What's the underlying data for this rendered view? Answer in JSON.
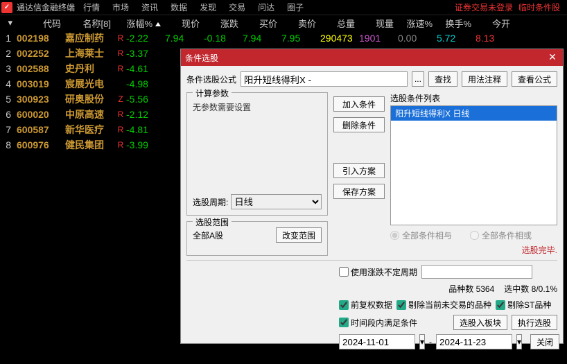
{
  "topbar": {
    "title": "通达信金融终端",
    "menu": [
      "行情",
      "市场",
      "资讯",
      "数据",
      "发现",
      "交易",
      "问达",
      "圈子"
    ],
    "right": [
      "证券交易未登录",
      "临时条件股"
    ]
  },
  "columns": {
    "idx": "",
    "code": "代码",
    "name": "名称[8]",
    "pct": "涨幅%",
    "price": "现价",
    "chg": "涨跌",
    "bid": "买价",
    "ask": "卖价",
    "vol": "总量",
    "amt": "现量",
    "speed": "涨速%",
    "turn": "换手%",
    "open": "今开"
  },
  "rows": [
    {
      "idx": "1",
      "code": "002198",
      "name": "嘉应制药",
      "flag": "R",
      "pct": "-2.22",
      "price": "7.94",
      "chg": "-0.18",
      "bid": "7.94",
      "ask": "7.95",
      "vol": "290473",
      "amt": "1901",
      "speed": "0.00",
      "turn": "5.72",
      "open": "8.13"
    },
    {
      "idx": "2",
      "code": "002252",
      "name": "上海莱士",
      "flag": "R",
      "pct": "-3.37"
    },
    {
      "idx": "3",
      "code": "002588",
      "name": "史丹利",
      "flag": "R",
      "pct": "-4.61"
    },
    {
      "idx": "4",
      "code": "003019",
      "name": "宸展光电",
      "flag": "",
      "pct": "-4.98"
    },
    {
      "idx": "5",
      "code": "300923",
      "name": "研奥股份",
      "flag": "Z",
      "pct": "-5.56"
    },
    {
      "idx": "6",
      "code": "600020",
      "name": "中原高速",
      "flag": "R",
      "pct": "-2.12"
    },
    {
      "idx": "7",
      "code": "600587",
      "name": "新华医疗",
      "flag": "R",
      "pct": "-4.81"
    },
    {
      "idx": "8",
      "code": "600976",
      "name": "健民集团",
      "flag": "R",
      "pct": "-3.99"
    }
  ],
  "dialog": {
    "title": "条件选股",
    "formula_label": "条件选股公式",
    "formula_input": "阳升短线得利X -",
    "btn_find": "查找",
    "btn_usage": "用法注释",
    "btn_view": "查看公式",
    "calc_legend": "计算参数",
    "calc_text": "无参数需要设置",
    "btn_add": "加入条件",
    "btn_del": "删除条件",
    "btn_import": "引入方案",
    "btn_save": "保存方案",
    "period_label": "选股周期:",
    "period_value": "日线",
    "scope_legend": "选股范围",
    "scope_text": "全部A股",
    "btn_scope": "改变范围",
    "cond_legend": "选股条件列表",
    "cond_item": "阳升短线得利X  日线",
    "radio_and": "全部条件相与",
    "radio_or": "全部条件相或",
    "status": "选股完毕.",
    "chk_custom": "使用涨跌不定周期",
    "custom_input": "",
    "stat_count_label": "品种数",
    "stat_count": "5364",
    "stat_hit_label": "选中数",
    "stat_hit": "8/0.1%",
    "chk_fuquan": "前复权数据",
    "chk_rmnotrading": "剔除当前未交易的品种",
    "chk_rmst": "剔除ST品种",
    "chk_timerange": "时间段内满足条件",
    "btn_addblock": "选股入板块",
    "btn_run": "执行选股",
    "date_from": "2024-11-01",
    "date_to": "2024-11-23",
    "btn_close": "关闭"
  }
}
